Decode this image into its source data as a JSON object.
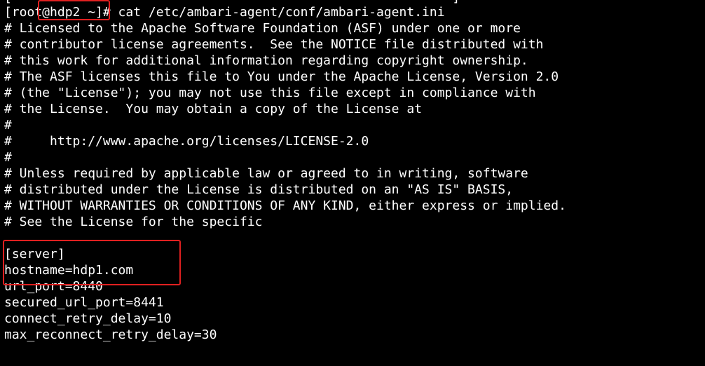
{
  "terminal": {
    "background": "#000000",
    "foreground": "#ffffff",
    "annotation_color": "#e02020",
    "top_partial_line": "[                                                          ]",
    "prompt": "[root@hdp2 ~]#",
    "command": " cat /etc/ambari-agent/conf/ambari-agent.ini",
    "lines": [
      "# Licensed to the Apache Software Foundation (ASF) under one or more",
      "# contributor license agreements.  See the NOTICE file distributed with",
      "# this work for additional information regarding copyright ownership.",
      "# The ASF licenses this file to You under the Apache License, Version 2.0",
      "# (the \"License\"); you may not use this file except in compliance with",
      "# the License.  You may obtain a copy of the License at",
      "#",
      "#     http://www.apache.org/licenses/LICENSE-2.0",
      "#",
      "# Unless required by applicable law or agreed to in writing, software",
      "# distributed under the License is distributed on an \"AS IS\" BASIS,",
      "# WITHOUT WARRANTIES OR CONDITIONS OF ANY KIND, either express or implied.",
      "# See the License for the specific",
      "",
      "[server]",
      "hostname=hdp1.com",
      "url_port=8440",
      "secured_url_port=8441",
      "connect_retry_delay=10",
      "max_reconnect_retry_delay=30"
    ]
  }
}
